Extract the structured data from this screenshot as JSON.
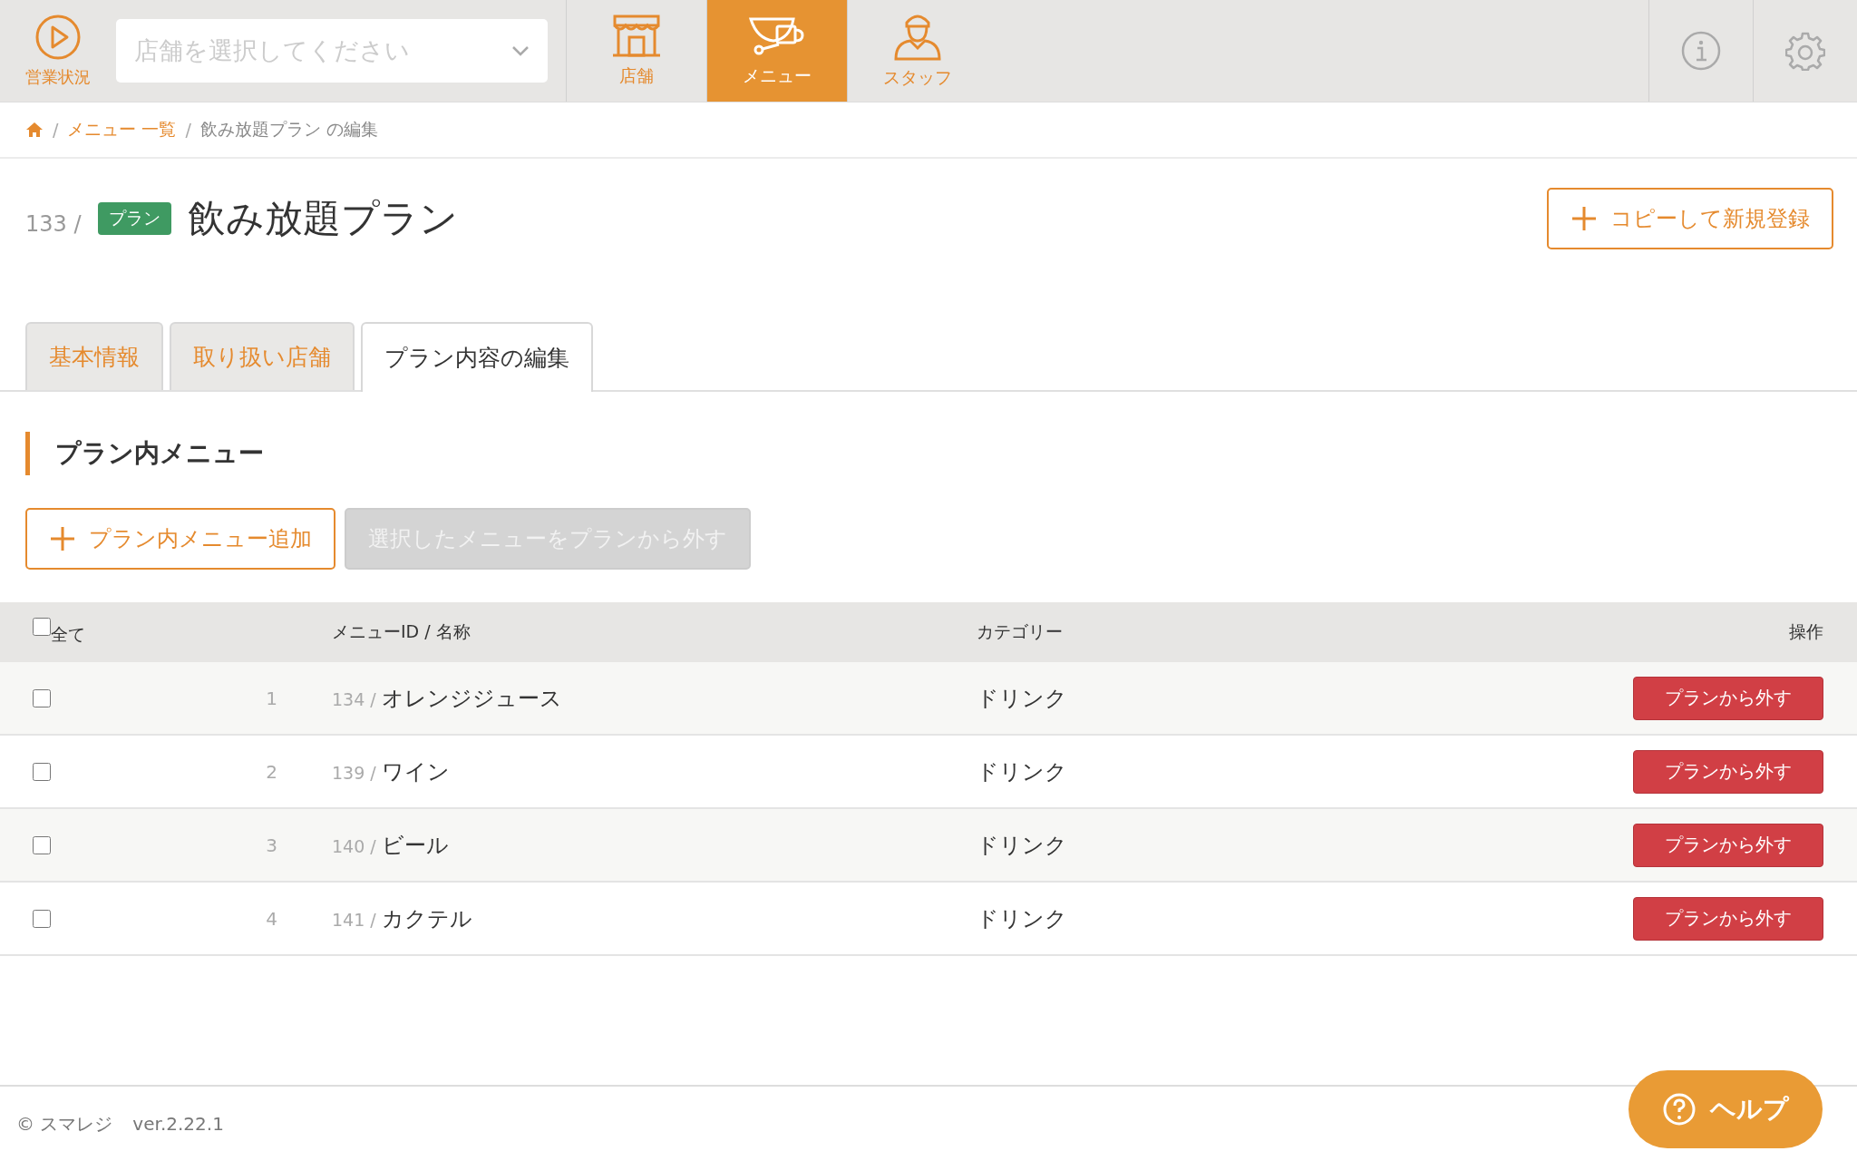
{
  "header": {
    "status_label": "営業状況",
    "store_select": {
      "placeholder": "店舗を選択してください"
    },
    "nav": [
      {
        "label": "店舗",
        "selected": false
      },
      {
        "label": "メニュー",
        "selected": true
      },
      {
        "label": "スタッフ",
        "selected": false
      }
    ]
  },
  "breadcrumb": [
    {
      "kind": "home"
    },
    {
      "kind": "link",
      "separator": "/",
      "label": "メニュー 一覧"
    },
    {
      "kind": "current",
      "separator": "/",
      "label": "飲み放題プラン の編集"
    }
  ],
  "title": {
    "id": "133 /",
    "badge": "プラン",
    "name": "飲み放題プラン"
  },
  "copy_button": "コピーして新規登録",
  "tabs": [
    {
      "label": "基本情報",
      "selected": false
    },
    {
      "label": "取り扱い店舗",
      "selected": false
    },
    {
      "label": "プラン内容の編集",
      "selected": true
    }
  ],
  "section_title": "プラン内メニュー",
  "actions": [
    {
      "label": "プラン内メニュー追加",
      "kind": "add",
      "disabled": false
    },
    {
      "label": "選択したメニューをプランから外す",
      "kind": "remove",
      "disabled": true
    }
  ],
  "table": {
    "select_all": {
      "label": "全て",
      "checked": false
    },
    "columns": [
      "メニューID / 名称",
      "カテゴリー",
      "操作"
    ],
    "rows": [
      {
        "checked": false,
        "no": "1",
        "id": "134 /",
        "name": "オレンジジュース",
        "category": "ドリンク",
        "action": "プランから外す"
      },
      {
        "checked": false,
        "no": "2",
        "id": "139 /",
        "name": "ワイン",
        "category": "ドリンク",
        "action": "プランから外す"
      },
      {
        "checked": false,
        "no": "3",
        "id": "140 /",
        "name": "ビール",
        "category": "ドリンク",
        "action": "プランから外す"
      },
      {
        "checked": false,
        "no": "4",
        "id": "141 /",
        "name": "カクテル",
        "category": "ドリンク",
        "action": "プランから外す"
      }
    ]
  },
  "footer": {
    "copyright": "© スマレジ",
    "version": "ver.2.22.1"
  },
  "help_button": "ヘルプ"
}
